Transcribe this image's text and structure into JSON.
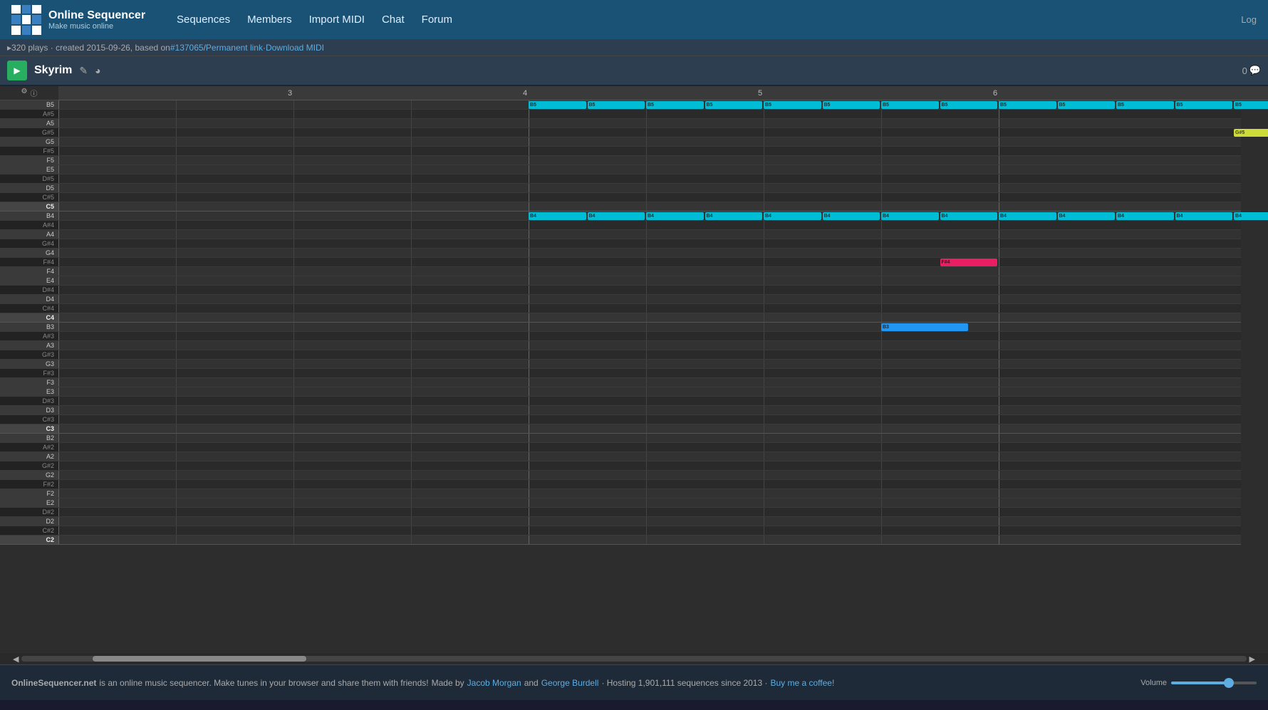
{
  "nav": {
    "logo_main": "Online Sequencer",
    "logo_sub": "Make music online",
    "links": [
      "Sequences",
      "Members",
      "Import MIDI",
      "Chat",
      "Forum"
    ],
    "login": "Log"
  },
  "info_bar": {
    "text": "320 plays · created 2015-09-26, based on ",
    "ref_link": "#137065",
    "sep1": " / ",
    "perm_link": "Permanent link",
    "sep2": " · ",
    "dl_link": "Download MIDI"
  },
  "toolbar": {
    "title": "Skyrim",
    "comment_count": "0"
  },
  "piano": {
    "notes": [
      "B5",
      "A#5",
      "A5",
      "G#5",
      "G5",
      "F#5",
      "F5",
      "E5",
      "D#5",
      "D5",
      "C#5",
      "C5",
      "B4",
      "A#4",
      "A4",
      "G#4",
      "G4",
      "F#4",
      "F4",
      "E4",
      "D#4",
      "D4",
      "C#4",
      "C4",
      "B3",
      "A#3",
      "A3",
      "G#3",
      "G3",
      "F#3",
      "F3",
      "E3",
      "D#3",
      "D3",
      "C#3",
      "C3",
      "B2",
      "A#2",
      "A2",
      "G#2",
      "G2",
      "F#2",
      "F2",
      "E2",
      "D#2",
      "D2",
      "C#2",
      "C2"
    ]
  },
  "beat_markers": [
    "3",
    "4",
    "5",
    "6"
  ],
  "footer": {
    "text1": "OnlineSequencer.net",
    "text2": " is an online music sequencer. Make tunes in your browser and share them with friends!",
    "text3": "Made by ",
    "author1": "Jacob Morgan",
    "text4": " and ",
    "author2": "George Burdell",
    "text5": " · Hosting 1,901,111 sequences since 2013 · ",
    "coffee_link": "Buy me a coffee!",
    "vol_label": "Volume"
  }
}
